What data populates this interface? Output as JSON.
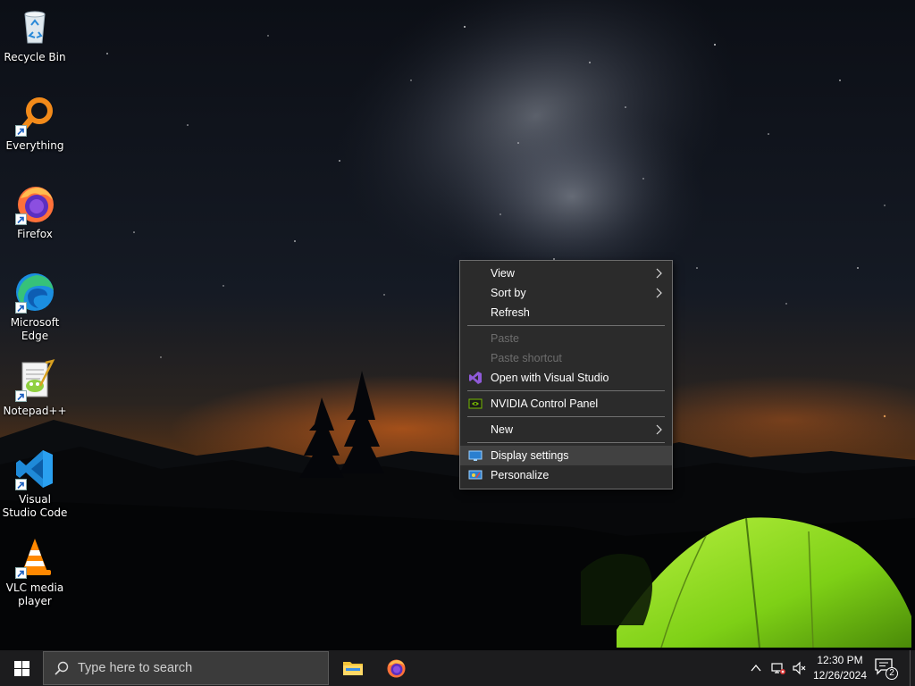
{
  "desktop": {
    "icons": [
      {
        "label": "Recycle Bin",
        "icon": "recycle-bin-icon",
        "shortcut": false
      },
      {
        "label": "Everything",
        "icon": "everything-search-icon",
        "shortcut": true
      },
      {
        "label": "Firefox",
        "icon": "firefox-icon",
        "shortcut": true
      },
      {
        "label": "Microsoft Edge",
        "icon": "edge-icon",
        "shortcut": true
      },
      {
        "label": "Notepad++",
        "icon": "notepadpp-icon",
        "shortcut": true
      },
      {
        "label": "Visual Studio Code",
        "icon": "vscode-icon",
        "shortcut": true
      },
      {
        "label": "VLC media player",
        "icon": "vlc-icon",
        "shortcut": true
      }
    ]
  },
  "context_menu": {
    "items": [
      {
        "label": "View",
        "submenu": true
      },
      {
        "label": "Sort by",
        "submenu": true
      },
      {
        "label": "Refresh"
      },
      {
        "label": "Paste",
        "disabled": true
      },
      {
        "label": "Paste shortcut",
        "disabled": true
      },
      {
        "label": "Open with Visual Studio",
        "icon": "visual-studio-icon"
      },
      {
        "label": "NVIDIA Control Panel",
        "icon": "nvidia-icon"
      },
      {
        "label": "New",
        "submenu": true
      },
      {
        "label": "Display settings",
        "icon": "display-icon",
        "highlighted": true
      },
      {
        "label": "Personalize",
        "icon": "personalize-icon"
      }
    ]
  },
  "taskbar": {
    "search_placeholder": "Type here to search",
    "pinned": [
      {
        "name": "File Explorer",
        "icon": "folder-icon"
      },
      {
        "name": "Firefox",
        "icon": "firefox-icon"
      }
    ],
    "clock": {
      "time": "12:30 PM",
      "date": "12/26/2024"
    },
    "notification_count": "2"
  },
  "colors": {
    "menu_bg": "#2b2b2b",
    "menu_highlight": "#414141",
    "taskbar_bg": "#1c1c1e",
    "search_bg": "#3b3b3b"
  }
}
